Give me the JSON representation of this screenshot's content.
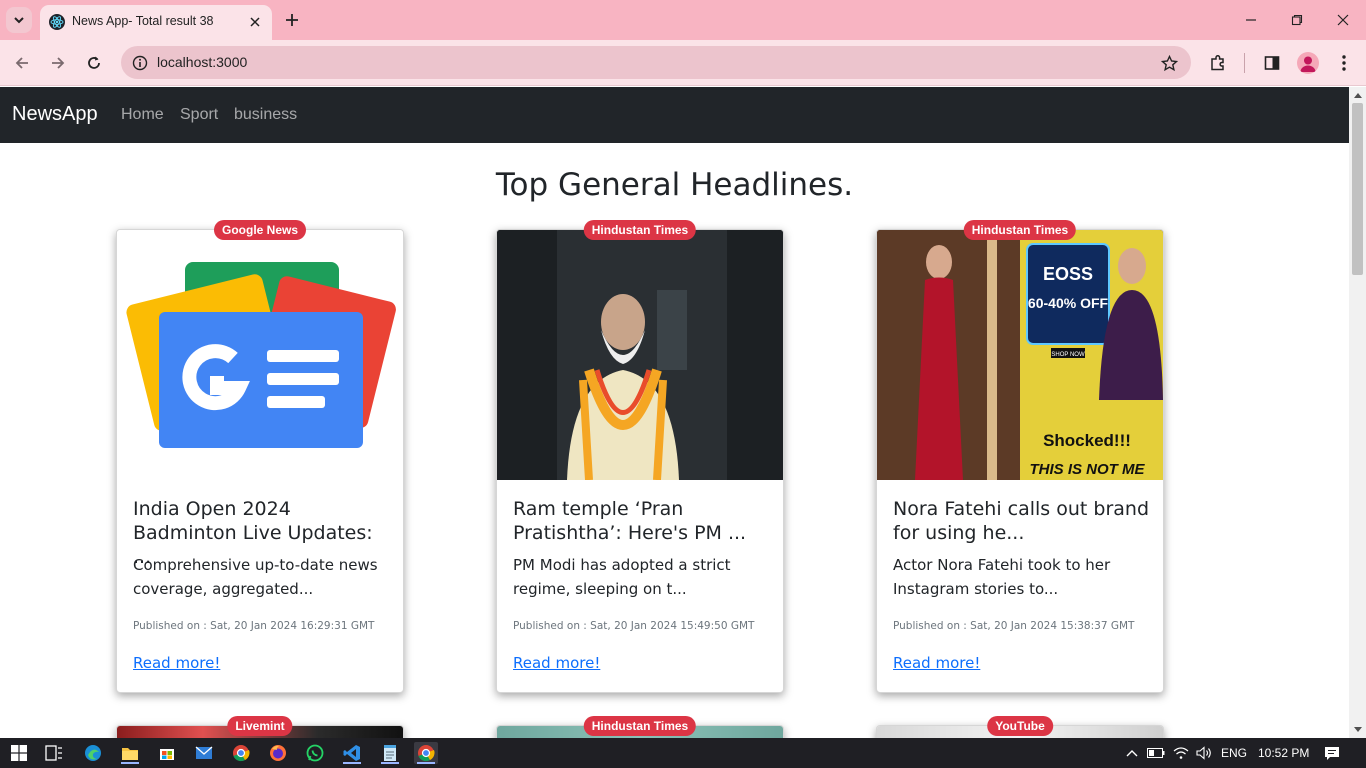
{
  "browser": {
    "tab_title": "News App- Total result 38",
    "url": "localhost:3000"
  },
  "navbar": {
    "brand": "NewsApp",
    "links": [
      "Home",
      "Sport",
      "business"
    ]
  },
  "page": {
    "heading": "Top General Headlines."
  },
  "cards": [
    {
      "source": "Google News",
      "title": "India Open 2024 Badminton Live Updates: ...",
      "description": "Comprehensive up-to-date news coverage, aggregated...",
      "published": "Published on : Sat, 20 Jan 2024 16:29:31 GMT",
      "link_label": "Read more!"
    },
    {
      "source": "Hindustan Times",
      "title": "Ram temple ‘Pran Pratishtha’: Here's PM ...",
      "description": "PM Modi has adopted a strict regime, sleeping on t...",
      "published": "Published on : Sat, 20 Jan 2024 15:49:50 GMT",
      "link_label": "Read more!"
    },
    {
      "source": "Hindustan Times",
      "title": "Nora Fatehi calls out brand for using he...",
      "description": "Actor Nora Fatehi took to her Instagram stories to...",
      "published": "Published on : Sat, 20 Jan 2024 15:38:37 GMT",
      "link_label": "Read more!"
    }
  ],
  "partial_cards": [
    {
      "source": "Livemint"
    },
    {
      "source": "Hindustan Times"
    },
    {
      "source": "YouTube"
    }
  ],
  "image_text": {
    "ad_line1": "EOSS",
    "ad_line2": "60-40% OFF",
    "ad_shop": "SHOP NOW",
    "ad_shocked": "Shocked!!!",
    "ad_notme": "THIS IS NOT ME"
  },
  "taskbar": {
    "language": "ENG",
    "time": "10:52 PM"
  },
  "colors": {
    "tabbar": "#f8b4c2",
    "toolbar": "#fbe3e8",
    "navbar": "#212529",
    "badge": "#dc3545",
    "link": "#0d6efd"
  }
}
